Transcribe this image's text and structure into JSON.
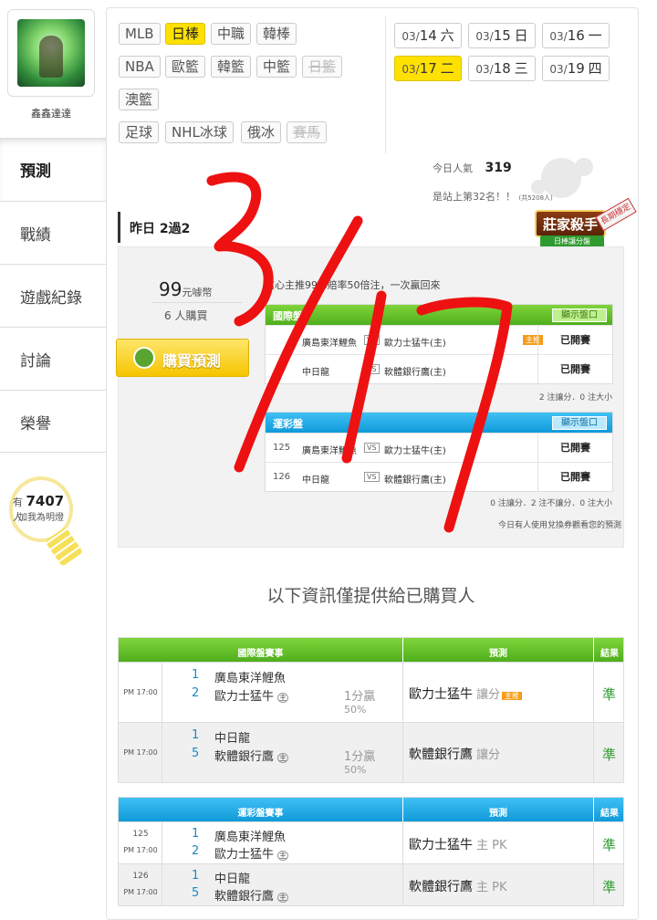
{
  "sidebar": {
    "username": "鑫鑫達達",
    "nav": [
      "預測",
      "戰績",
      "遊戲紀錄",
      "討論",
      "榮譽"
    ],
    "lamp": {
      "prefix": "有",
      "count": "7407",
      "suffix": "人",
      "sub": "加我為明燈"
    }
  },
  "sports": {
    "row1": [
      "MLB",
      "日棒",
      "中職",
      "韓棒"
    ],
    "row2": [
      "NBA",
      "歐籃",
      "韓籃",
      "中籃",
      "日籃"
    ],
    "row3": [
      "澳籃"
    ],
    "row4": [
      "足球",
      "NHL冰球",
      "俄冰",
      "賽馬"
    ]
  },
  "dates": [
    {
      "md": "03/",
      "d": "14",
      "w": "六"
    },
    {
      "md": "03/",
      "d": "15",
      "w": "日"
    },
    {
      "md": "03/",
      "d": "16",
      "w": "一"
    },
    {
      "md": "03/",
      "d": "17",
      "w": "二"
    },
    {
      "md": "03/",
      "d": "18",
      "w": "三"
    },
    {
      "md": "03/",
      "d": "19",
      "w": "四"
    }
  ],
  "stats": {
    "popularity_label": "今日人氣",
    "popularity": "319",
    "rank_text": "是站上第32名！！",
    "rank_note": "(共5208人)"
  },
  "stamp": {
    "main": "莊家殺手",
    "sub": "日棒讓分盤",
    "tag": "長期穩定"
  },
  "record": "昨日 2過2",
  "panel": {
    "price": "99",
    "price_unit": "元噱幣",
    "buyers": "6 人購買",
    "buy_button": "購買預測",
    "headline": "信心主推99%賠率50倍注，一次贏回來",
    "intl": {
      "title": "國際盤",
      "show": "顯示盤口",
      "rows": [
        {
          "no": "",
          "t1": "廣島東洋鯉魚",
          "t2": "歐力士猛牛(主)",
          "host": "主推",
          "res": "已開賽"
        },
        {
          "no": "",
          "t1": "中日龍",
          "t2": "軟體銀行鷹(主)",
          "host": "",
          "res": "已開賽"
        }
      ],
      "foot": "2 注讓分．0 注大小"
    },
    "lottery": {
      "title": "運彩盤",
      "show": "顯示盤口",
      "rows": [
        {
          "no": "125",
          "t1": "廣島東洋鯉魚",
          "t2": "歐力士猛牛(主)",
          "res": "已開賽"
        },
        {
          "no": "126",
          "t1": "中日龍",
          "t2": "軟體銀行鷹(主)",
          "res": "已開賽"
        }
      ],
      "foot": "0 注讓分．2 注不讓分．0 注大小"
    },
    "coupon_note": "今日有人使用兌換券觀看您的預測"
  },
  "info_title": "以下資訊僅提供給已購買人",
  "table_intl": {
    "head": [
      "國際盤賽事",
      "預測",
      "結果"
    ],
    "rows": [
      {
        "time": "PM 17:00",
        "n1": "1",
        "t1": "廣島東洋鯉魚",
        "n2": "2",
        "t2": "歐力士猛牛",
        "host": "主",
        "hc": "1分贏",
        "pct": "50%",
        "pick": "歐力士猛牛",
        "pick_type": "讓分",
        "hot": "主推",
        "result": "準"
      },
      {
        "time": "PM 17:00",
        "n1": "1",
        "t1": "中日龍",
        "n2": "5",
        "t2": "軟體銀行鷹",
        "host": "主",
        "hc": "1分贏",
        "pct": "50%",
        "pick": "軟體銀行鷹",
        "pick_type": "讓分",
        "hot": "",
        "result": "準"
      }
    ]
  },
  "table_lottery": {
    "head": [
      "運彩盤賽事",
      "預測",
      "結果"
    ],
    "rows": [
      {
        "no": "125",
        "time": "PM 17:00",
        "n1": "1",
        "t1": "廣島東洋鯉魚",
        "n2": "2",
        "t2": "歐力士猛牛",
        "host": "主",
        "pick": "歐力士猛牛",
        "pick_type": "主 PK",
        "result": "準"
      },
      {
        "no": "126",
        "time": "PM 17:00",
        "n1": "1",
        "t1": "中日龍",
        "n2": "5",
        "t2": "軟體銀行鷹",
        "host": "主",
        "pick": "軟體銀行鷹",
        "pick_type": "主 PK",
        "result": "準"
      }
    ]
  },
  "annotation": "3/17",
  "colors": {
    "accent_yellow": "#ffe100",
    "green": "#4fae1d",
    "blue": "#109ad8",
    "scribble": "#ee1111"
  }
}
